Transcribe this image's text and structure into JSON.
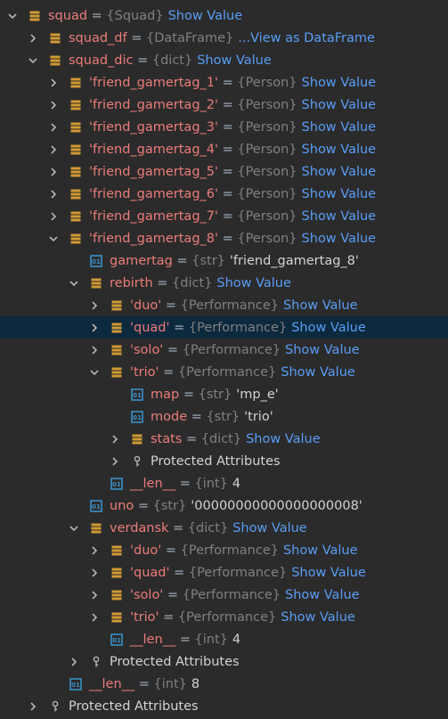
{
  "colors": {
    "background": "#2b2b2b",
    "selected_row": "#0d293e",
    "name": "#ec7c7a",
    "type": "#808080",
    "link": "#589df6",
    "value": "#d3d3d3",
    "icon_field": "#d19a34",
    "icon_prim": "#3a8fc7"
  },
  "rows": [
    {
      "depth": 1,
      "arrow": "down",
      "icon": "field-icon",
      "name": "squad",
      "type": "{Squad}",
      "link": "Show Value"
    },
    {
      "depth": 2,
      "arrow": "right",
      "icon": "field-icon",
      "name": "squad_df",
      "type": "{DataFrame}",
      "link": "...View as DataFrame"
    },
    {
      "depth": 2,
      "arrow": "down",
      "icon": "field-icon",
      "name": "squad_dic",
      "type": "{dict}",
      "link": "Show Value"
    },
    {
      "depth": 3,
      "arrow": "right",
      "icon": "field-icon",
      "name": "'friend_gamertag_1'",
      "type": "{Person}",
      "link": "Show Value"
    },
    {
      "depth": 3,
      "arrow": "right",
      "icon": "field-icon",
      "name": "'friend_gamertag_2'",
      "type": "{Person}",
      "link": "Show Value"
    },
    {
      "depth": 3,
      "arrow": "right",
      "icon": "field-icon",
      "name": "'friend_gamertag_3'",
      "type": "{Person}",
      "link": "Show Value"
    },
    {
      "depth": 3,
      "arrow": "right",
      "icon": "field-icon",
      "name": "'friend_gamertag_4'",
      "type": "{Person}",
      "link": "Show Value"
    },
    {
      "depth": 3,
      "arrow": "right",
      "icon": "field-icon",
      "name": "'friend_gamertag_5'",
      "type": "{Person}",
      "link": "Show Value"
    },
    {
      "depth": 3,
      "arrow": "right",
      "icon": "field-icon",
      "name": "'friend_gamertag_6'",
      "type": "{Person}",
      "link": "Show Value"
    },
    {
      "depth": 3,
      "arrow": "right",
      "icon": "field-icon",
      "name": "'friend_gamertag_7'",
      "type": "{Person}",
      "link": "Show Value"
    },
    {
      "depth": 3,
      "arrow": "down",
      "icon": "field-icon",
      "name": "'friend_gamertag_8'",
      "type": "{Person}",
      "link": "Show Value"
    },
    {
      "depth": 4,
      "arrow": "none",
      "icon": "primitive-icon",
      "name": "gamertag",
      "type": "{str}",
      "value": "'friend_gamertag_8'"
    },
    {
      "depth": 4,
      "arrow": "down",
      "icon": "field-icon",
      "name": "rebirth",
      "type": "{dict}",
      "link": "Show Value"
    },
    {
      "depth": 5,
      "arrow": "right",
      "icon": "field-icon",
      "name": "'duo'",
      "type": "{Performance}",
      "link": "Show Value"
    },
    {
      "depth": 5,
      "arrow": "right",
      "icon": "field-icon",
      "name": "'quad'",
      "type": "{Performance}",
      "link": "Show Value",
      "selected": true
    },
    {
      "depth": 5,
      "arrow": "right",
      "icon": "field-icon",
      "name": "'solo'",
      "type": "{Performance}",
      "link": "Show Value"
    },
    {
      "depth": 5,
      "arrow": "down",
      "icon": "field-icon",
      "name": "'trio'",
      "type": "{Performance}",
      "link": "Show Value"
    },
    {
      "depth": 6,
      "arrow": "none",
      "icon": "primitive-icon",
      "name": "map",
      "type": "{str}",
      "value": "'mp_e'"
    },
    {
      "depth": 6,
      "arrow": "none",
      "icon": "primitive-icon",
      "name": "mode",
      "type": "{str}",
      "value": "'trio'"
    },
    {
      "depth": 6,
      "arrow": "right",
      "icon": "field-icon",
      "name": "stats",
      "type": "{dict}",
      "link": "Show Value"
    },
    {
      "depth": 6,
      "arrow": "right",
      "icon": "key-icon",
      "label": "Protected Attributes"
    },
    {
      "depth": 5,
      "arrow": "none",
      "icon": "primitive-icon",
      "name": "__len__",
      "type": "{int}",
      "value": "4"
    },
    {
      "depth": 4,
      "arrow": "none",
      "icon": "primitive-icon",
      "name": "uno",
      "type": "{str}",
      "value": "'00000000000000000008'"
    },
    {
      "depth": 4,
      "arrow": "down",
      "icon": "field-icon",
      "name": "verdansk",
      "type": "{dict}",
      "link": "Show Value"
    },
    {
      "depth": 5,
      "arrow": "right",
      "icon": "field-icon",
      "name": "'duo'",
      "type": "{Performance}",
      "link": "Show Value"
    },
    {
      "depth": 5,
      "arrow": "right",
      "icon": "field-icon",
      "name": "'quad'",
      "type": "{Performance}",
      "link": "Show Value"
    },
    {
      "depth": 5,
      "arrow": "right",
      "icon": "field-icon",
      "name": "'solo'",
      "type": "{Performance}",
      "link": "Show Value"
    },
    {
      "depth": 5,
      "arrow": "right",
      "icon": "field-icon",
      "name": "'trio'",
      "type": "{Performance}",
      "link": "Show Value"
    },
    {
      "depth": 5,
      "arrow": "none",
      "icon": "primitive-icon",
      "name": "__len__",
      "type": "{int}",
      "value": "4"
    },
    {
      "depth": 4,
      "arrow": "right",
      "icon": "key-icon",
      "label": "Protected Attributes"
    },
    {
      "depth": 3,
      "arrow": "none",
      "icon": "primitive-icon",
      "name": "__len__",
      "type": "{int}",
      "value": "8"
    },
    {
      "depth": 2,
      "arrow": "right",
      "icon": "key-icon",
      "label": "Protected Attributes"
    }
  ]
}
